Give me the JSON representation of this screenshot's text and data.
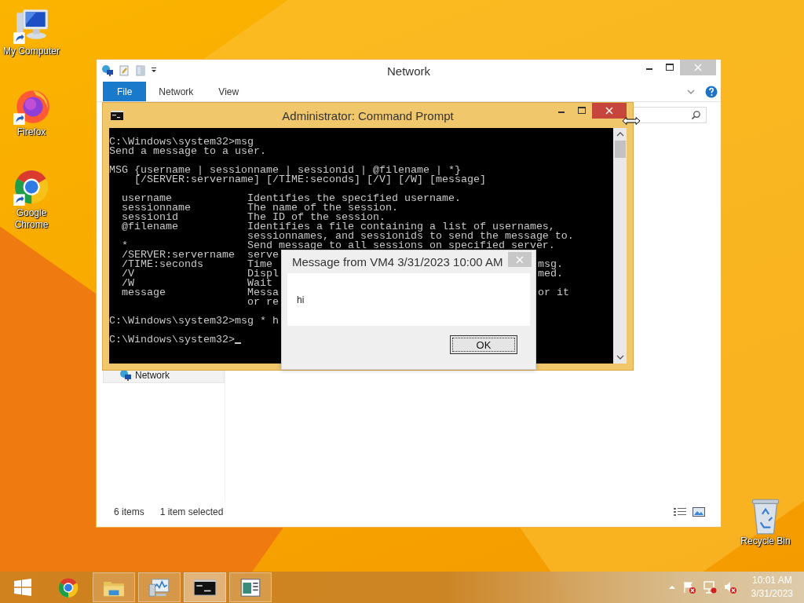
{
  "desktop_icons": [
    {
      "kind": "computer",
      "label": "My Computer"
    },
    {
      "kind": "firefox",
      "label": "Firefox"
    },
    {
      "kind": "chrome",
      "label": "Google Chrome"
    }
  ],
  "recycle_bin": {
    "label": "Recycle Bin"
  },
  "explorer": {
    "title": "Network",
    "ribbon_tabs": [
      {
        "label": "File",
        "selected": true
      },
      {
        "label": "Network",
        "selected": false
      },
      {
        "label": "View",
        "selected": false
      }
    ],
    "nav_items": [
      {
        "label": "Network",
        "selected": true
      }
    ],
    "status_bar": {
      "items": "6 items",
      "selection": "1 item selected"
    }
  },
  "console": {
    "title": "Administrator:  Command Prompt",
    "lines": [
      {
        "kind": "text",
        "text": "C:\\Windows\\system32>msg"
      },
      {
        "kind": "text",
        "text": "Send a message to a user."
      },
      {
        "kind": "blank"
      },
      {
        "kind": "text",
        "text": "MSG {username | sessionname | sessionid | @filename | *}"
      },
      {
        "kind": "text",
        "text": "    [/SERVER:servername] [/TIME:seconds] [/V] [/W] [message]"
      },
      {
        "kind": "blank"
      },
      {
        "kind": "text",
        "text": "  username            Identifies the specified username."
      },
      {
        "kind": "text",
        "text": "  sessionname         The name of the session."
      },
      {
        "kind": "text",
        "text": "  sessionid           The ID of the session."
      },
      {
        "kind": "text",
        "text": "  @filename           Identifies a file containing a list of usernames,"
      },
      {
        "kind": "text",
        "text": "                      sessionnames, and sessionids to send the message to."
      },
      {
        "kind": "text",
        "text": "  *                   Send message to all sessions on specified server."
      },
      {
        "kind": "text",
        "text": "  /SERVER:servername  serve"
      },
      {
        "kind": "text",
        "text": "  /TIME:seconds       Time",
        "tail": "msg."
      },
      {
        "kind": "text",
        "text": "  /V                  Displ",
        "tail": "med."
      },
      {
        "kind": "text",
        "text": "  /W                  Wait"
      },
      {
        "kind": "text",
        "text": "  message             Messa",
        "tail": "or it"
      },
      {
        "kind": "text",
        "text": "                      or re"
      },
      {
        "kind": "blank"
      },
      {
        "kind": "text",
        "text": "C:\\Windows\\system32>msg * h"
      },
      {
        "kind": "blank"
      },
      {
        "kind": "prompt",
        "text": "C:\\Windows\\system32>"
      }
    ]
  },
  "dialog": {
    "title": "Message from VM4 3/31/2023 10:00 AM",
    "message": "hi",
    "button": "OK"
  },
  "taskbar": {
    "buttons": [
      {
        "kind": "start",
        "running": false,
        "selected": false
      },
      {
        "kind": "chrome",
        "running": false,
        "selected": false
      },
      {
        "kind": "explorer",
        "running": true,
        "selected": false
      },
      {
        "kind": "monitor",
        "running": true,
        "selected": false
      },
      {
        "kind": "console",
        "running": true,
        "selected": true
      },
      {
        "kind": "document",
        "running": true,
        "selected": false
      }
    ],
    "clock": {
      "time": "10:01 AM",
      "date": "3/31/2023"
    }
  }
}
